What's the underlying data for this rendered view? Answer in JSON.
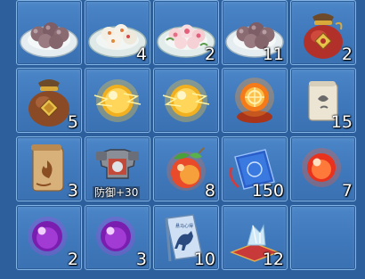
{
  "inventory": {
    "slots": [
      {
        "icon": "rice-ball-plate-icon",
        "count": ""
      },
      {
        "icon": "dumplings-plate-icon",
        "count": "4"
      },
      {
        "icon": "flower-dumplings-plate-icon",
        "count": "2"
      },
      {
        "icon": "rice-ball-plate-icon",
        "count": "11"
      },
      {
        "icon": "lucky-bag-icon",
        "count": "2"
      },
      {
        "icon": "lucky-bag-icon",
        "count": "5"
      },
      {
        "icon": "golden-orb-icon",
        "count": ""
      },
      {
        "icon": "golden-orb-icon",
        "count": ""
      },
      {
        "icon": "sun-crystal-orb-icon",
        "count": ""
      },
      {
        "icon": "scroll-icon",
        "count": "15"
      },
      {
        "icon": "fire-scroll-icon",
        "count": "3"
      },
      {
        "icon": "armor-icon",
        "count": "",
        "sub": "防御+30"
      },
      {
        "icon": "peach-fruit-icon",
        "count": "8"
      },
      {
        "icon": "blue-book-icon",
        "count": "150"
      },
      {
        "icon": "red-orb-icon",
        "count": "7"
      },
      {
        "icon": "purple-orb-icon",
        "count": "2"
      },
      {
        "icon": "purple-orb-icon",
        "count": "3"
      },
      {
        "icon": "horse-book-icon",
        "count": "10"
      },
      {
        "icon": "crystal-cushion-icon",
        "count": "12"
      },
      {
        "icon": "empty-slot",
        "count": ""
      }
    ],
    "book_title": "悬马心得"
  }
}
